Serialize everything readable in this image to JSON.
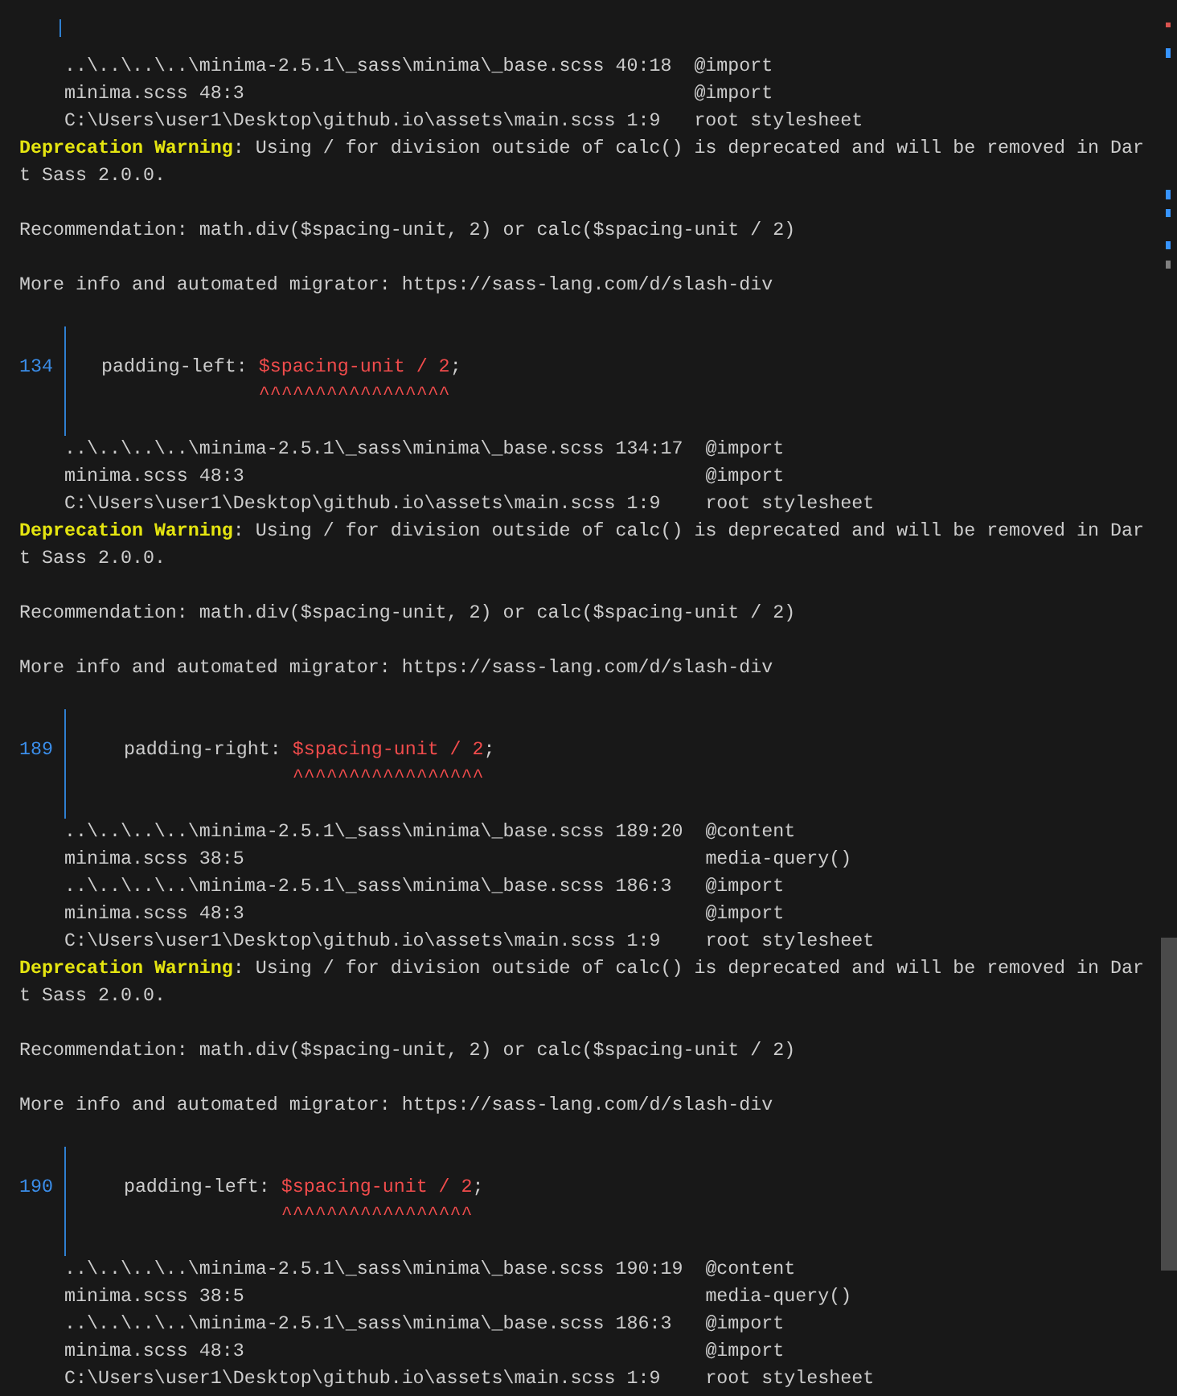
{
  "lines": [
    {
      "kind": "trace",
      "entries": [
        {
          "location": "..\\..\\..\\..\\minima-2.5.1\\_sass\\minima\\_base.scss 40:18",
          "label": "@import"
        },
        {
          "location": "minima.scss 48:3",
          "label": "@import"
        },
        {
          "location": "C:\\Users\\user1\\Desktop\\github.io\\assets\\main.scss 1:9",
          "label": "root stylesheet"
        }
      ]
    },
    {
      "kind": "warning",
      "text": "**Deprecation Warning**: Using / for division outside of calc() is deprecated and will be removed in Dart Sass 2.0.0."
    },
    {
      "kind": "blank"
    },
    {
      "kind": "text",
      "text": "Recommendation: math.div($spacing-unit, 2) or calc($spacing-unit / 2)"
    },
    {
      "kind": "blank"
    },
    {
      "kind": "text",
      "text": "More info and automated migrator: https://sass-lang.com/d/slash-div"
    },
    {
      "kind": "blank"
    },
    {
      "kind": "code",
      "line_number": "134",
      "prefix": "   padding-left: ",
      "highlight": "$spacing-unit / 2",
      "suffix": ";",
      "carets": "^^^^^^^^^^^^^^^^^"
    },
    {
      "kind": "trace",
      "entries": [
        {
          "location": "..\\..\\..\\..\\minima-2.5.1\\_sass\\minima\\_base.scss 134:17",
          "label": "@import"
        },
        {
          "location": "minima.scss 48:3",
          "label": "@import"
        },
        {
          "location": "C:\\Users\\user1\\Desktop\\github.io\\assets\\main.scss 1:9",
          "label": "root stylesheet"
        }
      ]
    },
    {
      "kind": "warning",
      "text": "**Deprecation Warning**: Using / for division outside of calc() is deprecated and will be removed in Dart Sass 2.0.0."
    },
    {
      "kind": "blank"
    },
    {
      "kind": "text",
      "text": "Recommendation: math.div($spacing-unit, 2) or calc($spacing-unit / 2)"
    },
    {
      "kind": "blank"
    },
    {
      "kind": "text",
      "text": "More info and automated migrator: https://sass-lang.com/d/slash-div"
    },
    {
      "kind": "blank"
    },
    {
      "kind": "code",
      "line_number": "189",
      "prefix": "     padding-right: ",
      "highlight": "$spacing-unit / 2",
      "suffix": ";",
      "carets": "^^^^^^^^^^^^^^^^^"
    },
    {
      "kind": "trace",
      "entries": [
        {
          "location": "..\\..\\..\\..\\minima-2.5.1\\_sass\\minima\\_base.scss 189:20",
          "label": "@content"
        },
        {
          "location": "minima.scss 38:5",
          "label": "media-query()"
        },
        {
          "location": "..\\..\\..\\..\\minima-2.5.1\\_sass\\minima\\_base.scss 186:3",
          "label": "@import"
        },
        {
          "location": "minima.scss 48:3",
          "label": "@import"
        },
        {
          "location": "C:\\Users\\user1\\Desktop\\github.io\\assets\\main.scss 1:9",
          "label": "root stylesheet"
        }
      ]
    },
    {
      "kind": "warning",
      "text": "**Deprecation Warning**: Using / for division outside of calc() is deprecated and will be removed in Dart Sass 2.0.0."
    },
    {
      "kind": "blank"
    },
    {
      "kind": "text",
      "text": "Recommendation: math.div($spacing-unit, 2) or calc($spacing-unit / 2)"
    },
    {
      "kind": "blank"
    },
    {
      "kind": "text",
      "text": "More info and automated migrator: https://sass-lang.com/d/slash-div"
    },
    {
      "kind": "blank"
    },
    {
      "kind": "code",
      "line_number": "190",
      "prefix": "     padding-left: ",
      "highlight": "$spacing-unit / 2",
      "suffix": ";",
      "carets": "^^^^^^^^^^^^^^^^^"
    },
    {
      "kind": "trace",
      "entries": [
        {
          "location": "..\\..\\..\\..\\minima-2.5.1\\_sass\\minima\\_base.scss 190:19",
          "label": "@content"
        },
        {
          "location": "minima.scss 38:5",
          "label": "media-query()"
        },
        {
          "location": "..\\..\\..\\..\\minima-2.5.1\\_sass\\minima\\_base.scss 186:3",
          "label": "@import"
        },
        {
          "location": "minima.scss 48:3",
          "label": "@import"
        },
        {
          "location": "C:\\Users\\user1\\Desktop\\github.io\\assets\\main.scss 1:9",
          "label": "root stylesheet"
        }
      ]
    }
  ]
}
